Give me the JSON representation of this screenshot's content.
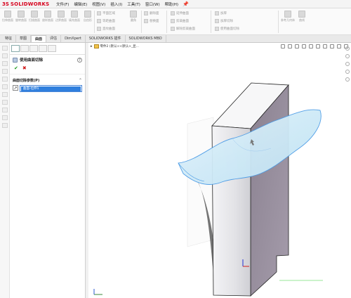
{
  "app": {
    "brand_ds": "3S",
    "brand_name": "SOLIDWORKS"
  },
  "menu": [
    "文件(F)",
    "编辑(E)",
    "视图(V)",
    "插入(I)",
    "工具(T)",
    "窗口(W)",
    "帮助(H)"
  ],
  "ribbon": {
    "buttons": [
      "拉伸曲面",
      "旋转曲面",
      "扫描曲面",
      "放样曲面",
      "边界曲面",
      "填充曲面",
      "自由形"
    ],
    "rows": [
      "平面区域",
      "等距曲面",
      "直纹曲面",
      "圆角",
      "删除面",
      "替换面",
      "延伸曲面",
      "剪裁曲面",
      "解除剪裁曲面",
      "加厚",
      "加厚切除",
      "使用曲面切除",
      "曲线",
      "参考几何体"
    ]
  },
  "tabs": [
    "特征",
    "草图",
    "曲面",
    "评估",
    "DimXpert",
    "SOLIDWORKS 插件",
    "SOLIDWORKS MBD"
  ],
  "active_tab": "曲面",
  "property_manager": {
    "title": "使用曲面切除",
    "group_title": "曲面切除参数(P)",
    "selected_item": "曲面-拉伸1"
  },
  "viewport": {
    "part_name": "零件2 (默认<<默认>_显..."
  },
  "colors": {
    "accent": "#2f7fde",
    "brand": "#d6001c",
    "ok": "#1a9a1a",
    "cancel": "#d01818"
  }
}
